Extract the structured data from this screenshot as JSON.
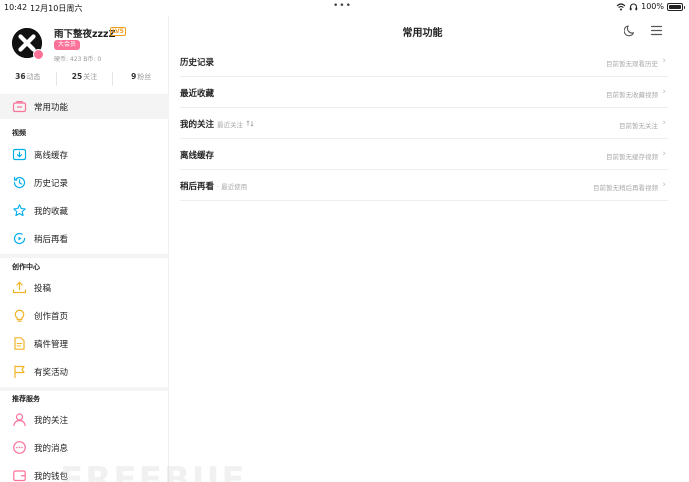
{
  "status_bar": {
    "time": "10:42",
    "date": "12月10日周六",
    "dots": "•••",
    "battery": "100%"
  },
  "profile": {
    "name": "雨下整夜zzzZ",
    "level": "LV5",
    "vip": "大会员",
    "coins": "硬币: 423  B币: 0",
    "stats": [
      {
        "num": "36",
        "label": "动态"
      },
      {
        "num": "25",
        "label": "关注"
      },
      {
        "num": "9",
        "label": "粉丝"
      }
    ]
  },
  "sidebar": {
    "top_item": "常用功能",
    "sections": [
      {
        "title": "视频",
        "items": [
          "离线缓存",
          "历史记录",
          "我的收藏",
          "稍后再看"
        ]
      },
      {
        "title": "创作中心",
        "items": [
          "投稿",
          "创作首页",
          "稿件管理",
          "有奖活动"
        ]
      },
      {
        "title": "推荐服务",
        "items": [
          "我的关注",
          "我的消息",
          "我的钱包"
        ]
      }
    ]
  },
  "header": {
    "title": "常用功能"
  },
  "rows": [
    {
      "title": "历史记录",
      "sub": "",
      "right": "目前暂无观看历史"
    },
    {
      "title": "最近收藏",
      "sub": "",
      "right": "目前暂无收藏视频"
    },
    {
      "title": "我的关注",
      "sub": "最近关注  ",
      "right": "目前暂无关注"
    },
    {
      "title": "离线缓存",
      "sub": "",
      "right": "目前暂无缓存视频"
    },
    {
      "title": "稍后再看",
      "sub": "· 最近使用",
      "right": "目前暂无稍后再看视频"
    }
  ],
  "colors": {
    "pink": "#fb7299",
    "blue": "#00aeec",
    "gold": "#f0b428",
    "text": "#222222",
    "muted": "#aaaaaa"
  },
  "watermark": "FREEBUF"
}
